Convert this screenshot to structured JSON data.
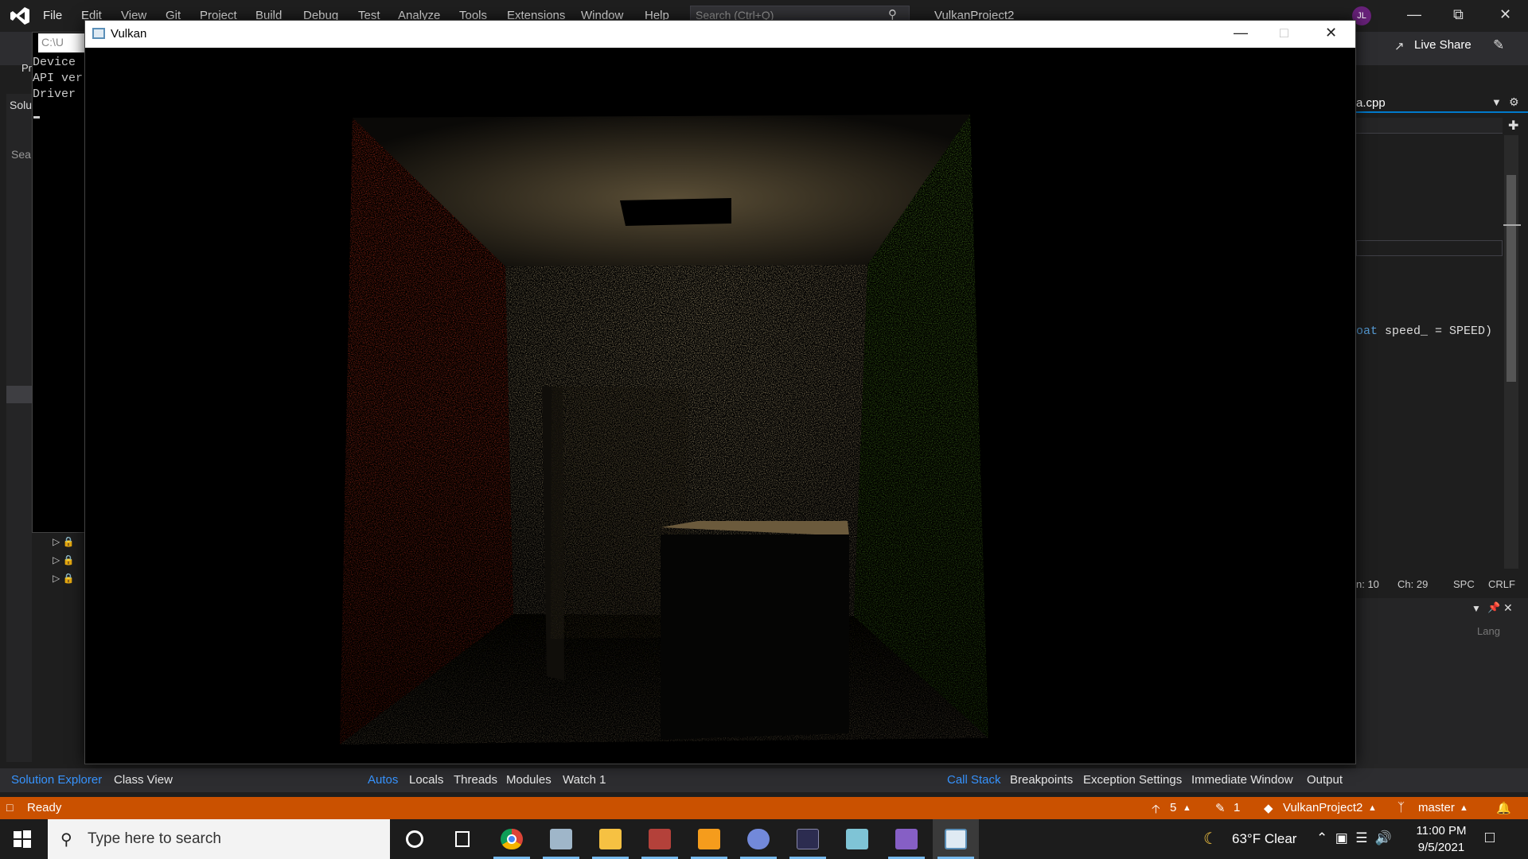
{
  "vs": {
    "menu": [
      "File",
      "Edit",
      "View",
      "Git",
      "Project",
      "Build",
      "Debug",
      "Test",
      "Analyze",
      "Tools",
      "Extensions",
      "Window",
      "Help"
    ],
    "search_placeholder": "Search (Ctrl+Q)",
    "project_title": "VulkanProject2",
    "user_initials": "JL",
    "live_share": "Live Share",
    "left_panel": {
      "header": "Solu",
      "search": "Sea",
      "pr_label": "Pr"
    },
    "console": {
      "title": "C:\\U",
      "lines": [
        "Device",
        "API ver",
        "Driver"
      ]
    },
    "editor": {
      "tab_label": "a.cpp",
      "code_keyword": "oat",
      "code_rest": " speed_ = SPEED)"
    },
    "status_line": {
      "ln": "n: 10",
      "ch": "Ch: 29",
      "spc": "SPC",
      "crlf": "CRLF"
    },
    "right_panel_lang": "Lang",
    "bottom_tabs_left": [
      "Solution Explorer",
      "Class View"
    ],
    "bottom_tabs_mid": [
      "Autos",
      "Locals",
      "Threads",
      "Modules",
      "Watch 1"
    ],
    "bottom_tabs_right": [
      "Call Stack",
      "Breakpoints",
      "Exception Settings",
      "Immediate Window",
      "Output"
    ],
    "statusbar": {
      "ready": "Ready",
      "up_count": "5",
      "edit_count": "1",
      "repo": "VulkanProject2",
      "branch": "master"
    }
  },
  "vulkan_window": {
    "title": "Vulkan",
    "scene": "cornell-box-path-traced"
  },
  "taskbar": {
    "search_placeholder": "Type here to search",
    "apps": [
      "cortana",
      "task-view",
      "chrome",
      "photos",
      "file-explorer",
      "media",
      "sublime-text",
      "discord",
      "terminal",
      "notepad",
      "visual-studio",
      "vulkan-app"
    ],
    "weather": "63°F  Clear",
    "time": "11:00 PM",
    "date": "9/5/2021"
  },
  "colors": {
    "accent": "#007acc",
    "statusbar": "#ca5100",
    "red_wall": "#b2341d",
    "green_wall": "#4f8a1c",
    "back_wall": "#a89a76"
  }
}
